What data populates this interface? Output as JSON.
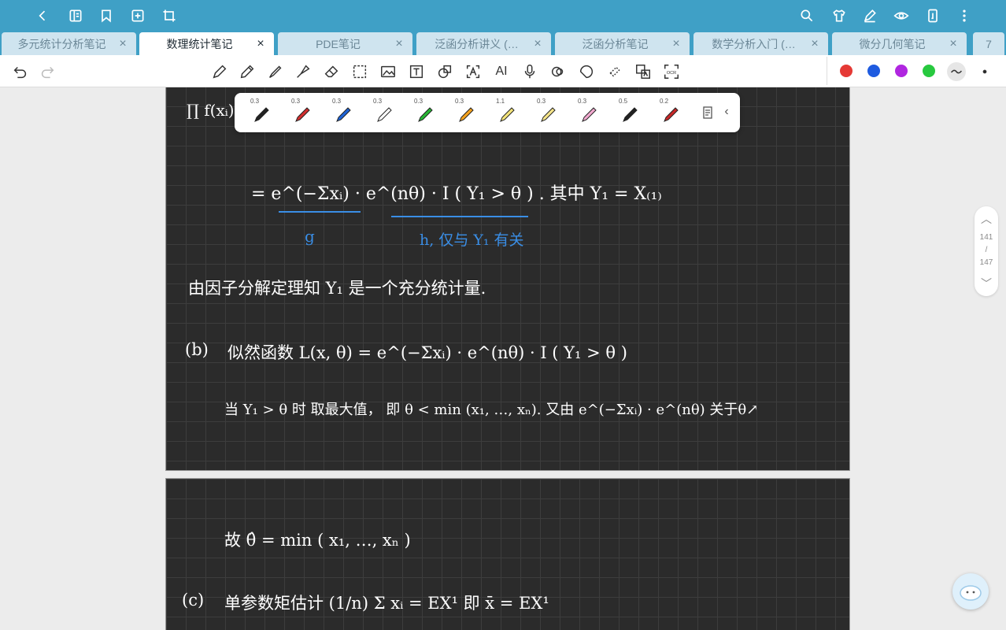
{
  "tabs": [
    {
      "label": "多元统计分析笔记",
      "active": false
    },
    {
      "label": "数理统计笔记",
      "active": true
    },
    {
      "label": "PDE笔记",
      "active": false
    },
    {
      "label": "泛函分析讲义 (…",
      "active": false
    },
    {
      "label": "泛函分析笔记",
      "active": false
    },
    {
      "label": "数学分析入门 (…",
      "active": false
    },
    {
      "label": "微分几何笔记",
      "active": false
    }
  ],
  "tab_overflow": "7",
  "colors": {
    "brand": "#3fa0c6",
    "red": "#e53935",
    "blue": "#1e5be0",
    "purple": "#b026e0",
    "green": "#27c93f"
  },
  "pens": [
    {
      "size": "0.3",
      "color": "#222222"
    },
    {
      "size": "0.3",
      "color": "#d32f2f"
    },
    {
      "size": "0.3",
      "color": "#1e63d6"
    },
    {
      "size": "0.3",
      "color": "#ffffff"
    },
    {
      "size": "0.3",
      "color": "#27b534"
    },
    {
      "size": "0.3",
      "color": "#f4a11d"
    },
    {
      "size": "1.1",
      "color": "#f4e47a"
    },
    {
      "size": "0.3",
      "color": "#f6e58a"
    },
    {
      "size": "0.3",
      "color": "#f2a9cf"
    },
    {
      "size": "0.5",
      "color": "#222222"
    },
    {
      "size": "0.2",
      "color": "#c62828"
    }
  ],
  "page_indicator": {
    "current": "141",
    "sep": "/",
    "total": "147"
  },
  "notes": {
    "line1": "∏ f(xᵢ)",
    "eq_main": "=   e^(−Σxᵢ)  ·  e^(nθ) · I ( Y₁ > θ )   .   其中 Y₁ = X₍₁₎",
    "g_label": "g",
    "h_label": "h, 仅与 Y₁ 有关",
    "stmt": "由因子分解定理知 Y₁ 是一个充分统计量.",
    "b_label": "(b)",
    "b_eq": "似然函数  L(x, θ) =  e^(−Σxᵢ) · e^(nθ) · I ( Y₁ > θ )",
    "b_line2": "当 Y₁ > θ 时 取最大值，  即 θ <  min (x₁, …, xₙ).    又由 e^(−Σxᵢ) · e^(nθ) 关于θ↗",
    "mle": "故  θ̂ = min ( x₁, …, xₙ )",
    "c_label": "(c)",
    "c_eq": "单参数矩估计  (1/n) Σ xᵢ = EX¹     即  x̄ = EX¹"
  }
}
